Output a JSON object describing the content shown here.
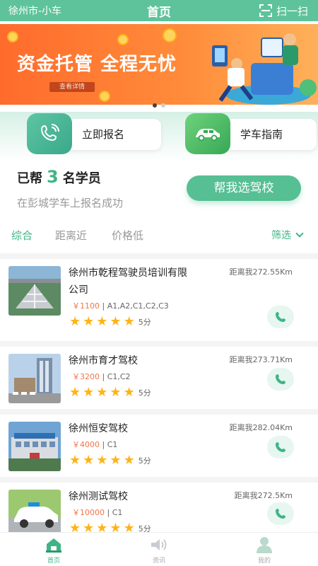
{
  "header": {
    "city": "徐州市-小车",
    "title": "首页",
    "scan_label": "扫一扫"
  },
  "banner": {
    "headline": "资金托管 全程无忧",
    "detail_button": "查看详情",
    "page_count": 2,
    "active_page": 1
  },
  "quick_actions": [
    {
      "label": "立即报名",
      "icon": "phone-icon"
    },
    {
      "label": "学车指南",
      "icon": "car-icon"
    }
  ],
  "stats": {
    "prefix": "已帮",
    "count": "3",
    "suffix": "名学员",
    "subtitle": "在彭城学车上报名成功",
    "select_button": "帮我选驾校"
  },
  "sort": {
    "tabs": [
      "综合",
      "距离近",
      "价格低"
    ],
    "active": "综合",
    "filter_label": "筛选"
  },
  "schools": [
    {
      "name": "徐州市乾程驾驶员培训有限公司",
      "distance": "距离我272.55Km",
      "price": "￥1100",
      "licenses": "A1,A2,C1,C2,C3",
      "rating": 5,
      "score": "5分"
    },
    {
      "name": "徐州市育才驾校",
      "distance": "距离我273.71Km",
      "price": "￥3200",
      "licenses": "C1,C2",
      "rating": 5,
      "score": "5分"
    },
    {
      "name": "徐州恒安驾校",
      "distance": "距离我282.04Km",
      "price": "￥4000",
      "licenses": "C1",
      "rating": 5,
      "score": "5分"
    },
    {
      "name": "徐州测试驾校",
      "distance": "距离我272.5Km",
      "price": "￥10000",
      "licenses": "C1",
      "rating": 5,
      "score": "5分"
    }
  ],
  "tabbar": [
    {
      "label": "首页",
      "icon": "home-icon",
      "active": true
    },
    {
      "label": "资讯",
      "icon": "speaker-icon",
      "active": false
    },
    {
      "label": "我的",
      "icon": "user-icon",
      "active": false
    }
  ],
  "colors": {
    "primary": "#5ec39b",
    "accent_green": "#3fb486",
    "price_orange": "#f0754b",
    "star": "#ffb415",
    "banner_orange": "#ff7a30"
  }
}
